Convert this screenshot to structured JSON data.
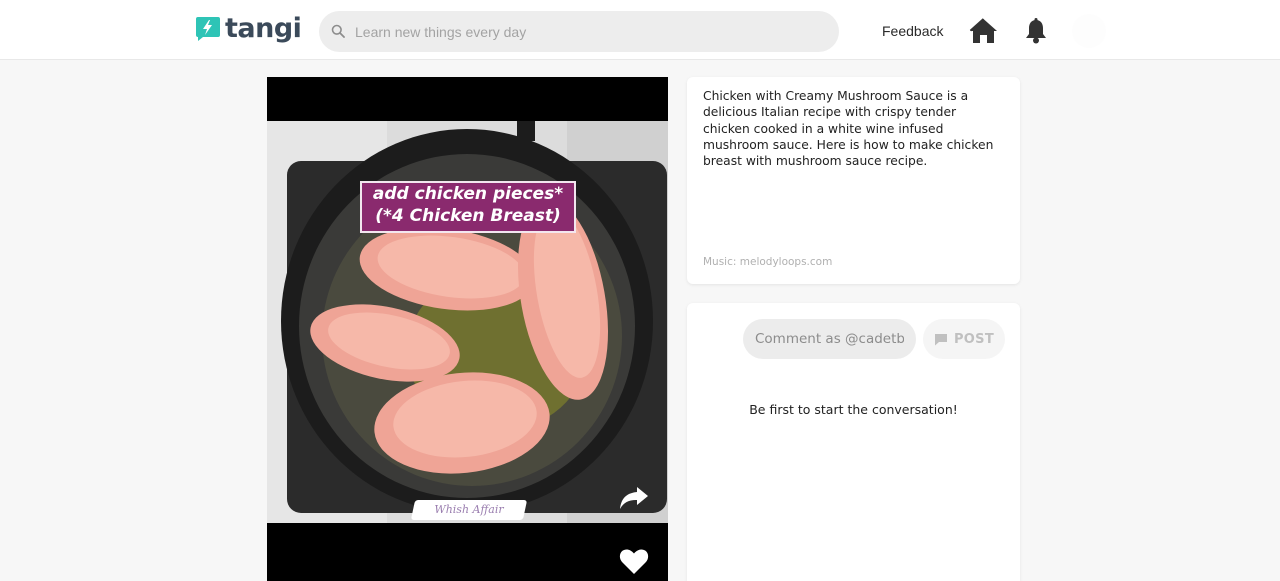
{
  "header": {
    "logo_text": "tangi",
    "search_placeholder": "Learn new things every day",
    "feedback_label": "Feedback"
  },
  "video": {
    "caption_line1": "add chicken pieces*",
    "caption_line2": "(*4 Chicken Breast)",
    "watermark": "Whish Affair"
  },
  "description": {
    "text": "Chicken with Creamy Mushroom Sauce is a delicious Italian recipe with crispy tender chicken cooked in a white wine infused mushroom sauce. Here is how to make chicken breast with mushroom sauce recipe.",
    "music_credit": "Music: melodyloops.com"
  },
  "comments": {
    "input_placeholder": "Comment as @cadetblue",
    "post_label": "POST",
    "empty_message": "Be first to start the conversation!"
  },
  "colors": {
    "brand": "#2ec4b6",
    "logo_text": "#3b4a5a",
    "caption_bg": "#8a2a6e"
  },
  "icons": [
    "search-icon",
    "home-icon",
    "bell-icon",
    "share-icon",
    "heart-icon",
    "comment-icon"
  ]
}
